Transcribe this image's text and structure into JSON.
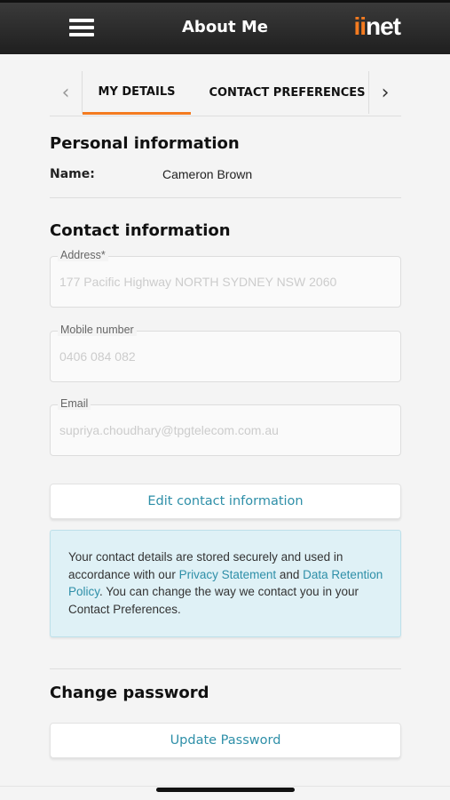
{
  "header": {
    "title": "About Me",
    "brand_prefix": "ii",
    "brand_suffix": "net",
    "menu_icon": "hamburger-menu-icon"
  },
  "tabs": {
    "items": [
      {
        "label": "MY DETAILS",
        "active": true
      },
      {
        "label": "CONTACT PREFERENCES",
        "active": false
      }
    ],
    "prev_icon": "chevron-left-icon",
    "next_icon": "chevron-right-icon"
  },
  "personal": {
    "title": "Personal information",
    "name_label": "Name:",
    "name_value": "Cameron Brown"
  },
  "contact": {
    "title": "Contact information",
    "fields": [
      {
        "label": "Address*",
        "value": "177 Pacific Highway NORTH SYDNEY NSW 2060"
      },
      {
        "label": "Mobile number",
        "value": "0406 084 082"
      },
      {
        "label": "Email",
        "value": "supriya.choudhary@tpgtelecom.com.au"
      }
    ],
    "edit_button": "Edit contact information"
  },
  "info": {
    "text_1": "Your contact details are stored securely and used in accordance with our ",
    "link_1": "Privacy Statement",
    "text_2": " and ",
    "link_2": "Data Retention Policy",
    "text_3": ". You can change the way we contact you in your Contact Preferences."
  },
  "password": {
    "title": "Change password",
    "button": "Update Password"
  },
  "colors": {
    "accent": "#f47b20",
    "link": "#2e8fa8",
    "info_bg": "#dff1f6",
    "header_bg": "#262626"
  }
}
